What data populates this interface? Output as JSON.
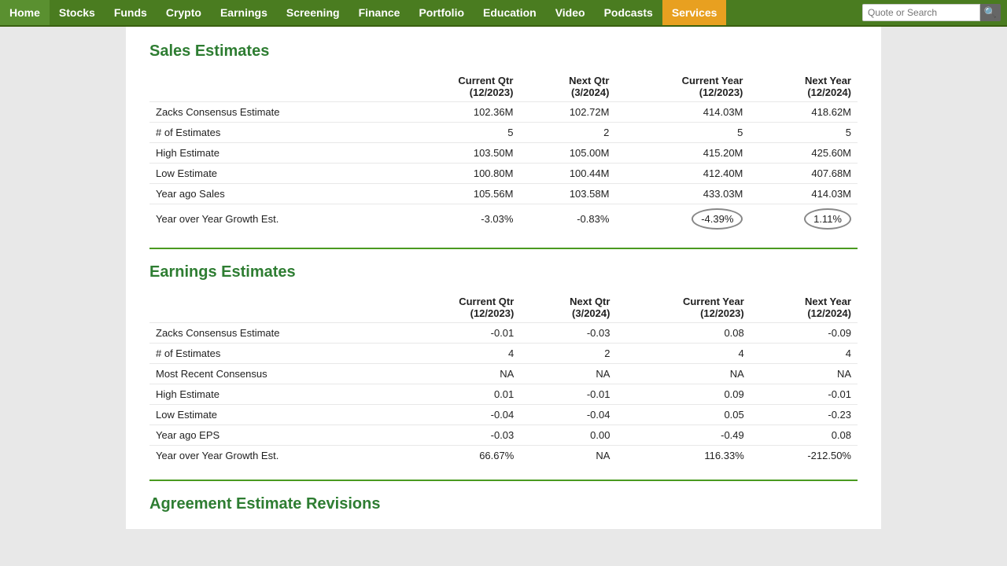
{
  "nav": {
    "items": [
      {
        "label": "Home",
        "class": "home",
        "active": false
      },
      {
        "label": "Stocks",
        "class": "",
        "active": false
      },
      {
        "label": "Funds",
        "class": "",
        "active": false
      },
      {
        "label": "Crypto",
        "class": "",
        "active": false
      },
      {
        "label": "Earnings",
        "class": "",
        "active": false
      },
      {
        "label": "Screening",
        "class": "",
        "active": false
      },
      {
        "label": "Finance",
        "class": "",
        "active": false
      },
      {
        "label": "Portfolio",
        "class": "",
        "active": false
      },
      {
        "label": "Education",
        "class": "",
        "active": false
      },
      {
        "label": "Video",
        "class": "",
        "active": false
      },
      {
        "label": "Podcasts",
        "class": "",
        "active": false
      },
      {
        "label": "Services",
        "class": "active",
        "active": true
      }
    ],
    "search_placeholder": "Quote or Search"
  },
  "sales_estimates": {
    "title": "Sales Estimates",
    "columns": [
      "",
      "Current Qtr\n(12/2023)",
      "Next Qtr\n(3/2024)",
      "Current Year\n(12/2023)",
      "Next Year\n(12/2024)"
    ],
    "col1": "Current Qtr",
    "col1sub": "(12/2023)",
    "col2": "Next Qtr",
    "col2sub": "(3/2024)",
    "col3": "Current Year",
    "col3sub": "(12/2023)",
    "col4": "Next Year",
    "col4sub": "(12/2024)",
    "rows": [
      {
        "label": "Zacks Consensus Estimate",
        "c1": "102.36M",
        "c2": "102.72M",
        "c3": "414.03M",
        "c4": "418.62M"
      },
      {
        "label": "# of Estimates",
        "c1": "5",
        "c2": "2",
        "c3": "5",
        "c4": "5"
      },
      {
        "label": "High Estimate",
        "c1": "103.50M",
        "c2": "105.00M",
        "c3": "415.20M",
        "c4": "425.60M"
      },
      {
        "label": "Low Estimate",
        "c1": "100.80M",
        "c2": "100.44M",
        "c3": "412.40M",
        "c4": "407.68M"
      },
      {
        "label": "Year ago Sales",
        "c1": "105.56M",
        "c2": "103.58M",
        "c3": "433.03M",
        "c4": "414.03M"
      },
      {
        "label": "Year over Year Growth Est.",
        "c1": "-3.03%",
        "c2": "-0.83%",
        "c3": "-4.39%",
        "c4": "1.11%",
        "c3_circled": true,
        "c4_circled": true
      }
    ]
  },
  "earnings_estimates": {
    "title": "Earnings Estimates",
    "col1": "Current Qtr",
    "col1sub": "(12/2023)",
    "col2": "Next Qtr",
    "col2sub": "(3/2024)",
    "col3": "Current Year",
    "col3sub": "(12/2023)",
    "col4": "Next Year",
    "col4sub": "(12/2024)",
    "rows": [
      {
        "label": "Zacks Consensus Estimate",
        "c1": "-0.01",
        "c2": "-0.03",
        "c3": "0.08",
        "c4": "-0.09"
      },
      {
        "label": "# of Estimates",
        "c1": "4",
        "c2": "2",
        "c3": "4",
        "c4": "4"
      },
      {
        "label": "Most Recent Consensus",
        "c1": "NA",
        "c2": "NA",
        "c3": "NA",
        "c4": "NA"
      },
      {
        "label": "High Estimate",
        "c1": "0.01",
        "c2": "-0.01",
        "c3": "0.09",
        "c4": "-0.01"
      },
      {
        "label": "Low Estimate",
        "c1": "-0.04",
        "c2": "-0.04",
        "c3": "0.05",
        "c4": "-0.23"
      },
      {
        "label": "Year ago EPS",
        "c1": "-0.03",
        "c2": "0.00",
        "c3": "-0.49",
        "c4": "0.08"
      },
      {
        "label": "Year over Year Growth Est.",
        "c1": "66.67%",
        "c2": "NA",
        "c3": "116.33%",
        "c4": "-212.50%"
      }
    ]
  },
  "agreement_section": {
    "title": "Agreement Estimate Revisions"
  }
}
